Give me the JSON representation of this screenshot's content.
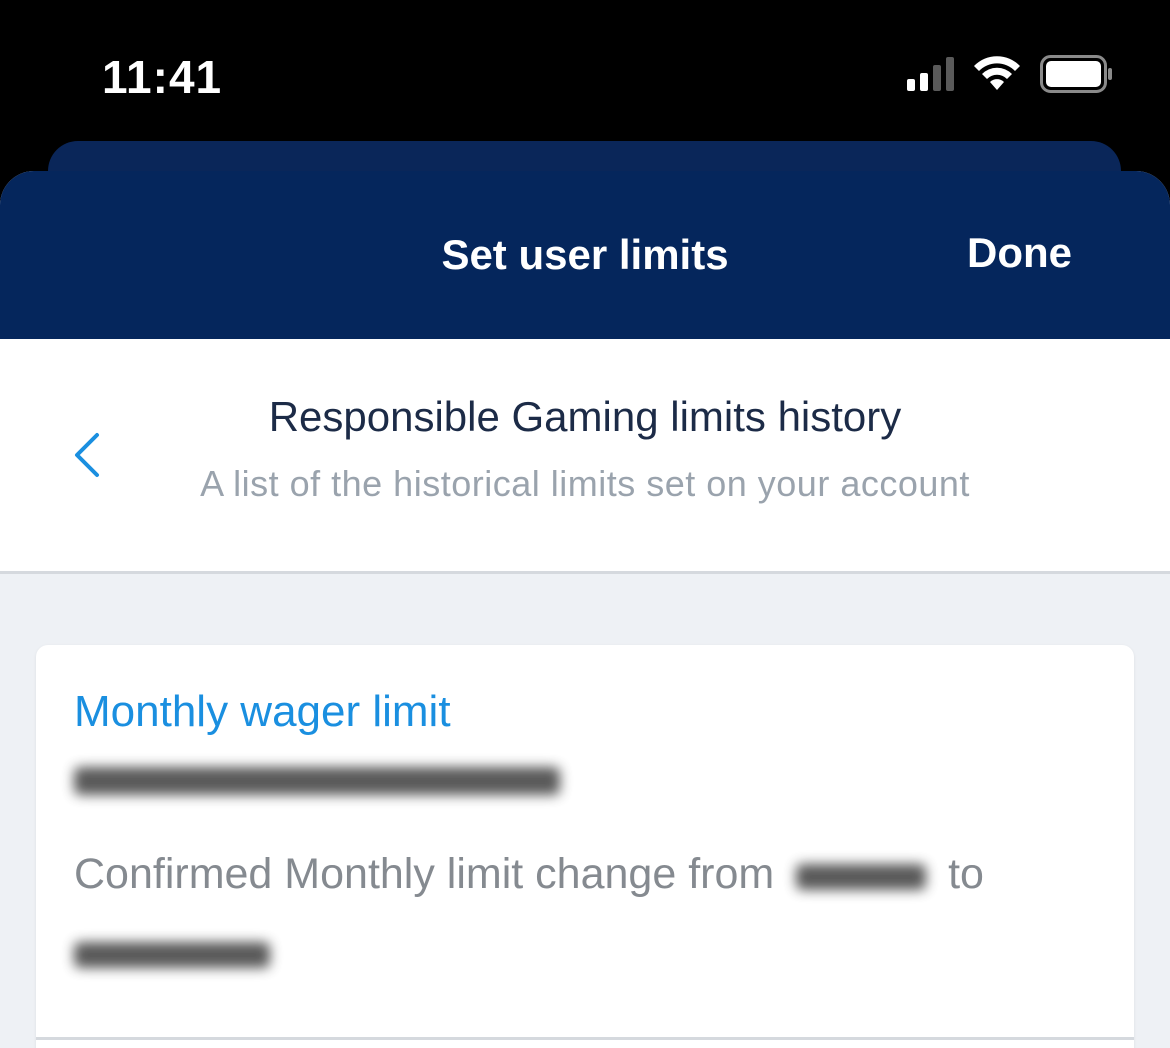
{
  "status_bar": {
    "time": "11:41",
    "icons": [
      "cellular-signal-icon",
      "wifi-icon",
      "battery-icon"
    ]
  },
  "nav": {
    "title": "Set user limits",
    "done_label": "Done"
  },
  "header": {
    "back_icon": "chevron-left-icon",
    "title": "Responsible Gaming limits history",
    "subtitle": "A list of the historical limits set on your account"
  },
  "history": {
    "items": [
      {
        "title": "Monthly wager limit",
        "description_prefix": "Confirmed Monthly limit change from",
        "description_middle": "to"
      }
    ]
  },
  "colors": {
    "nav_background": "#05265c",
    "accent": "#1a8fe0",
    "page_background": "#eef1f5"
  }
}
